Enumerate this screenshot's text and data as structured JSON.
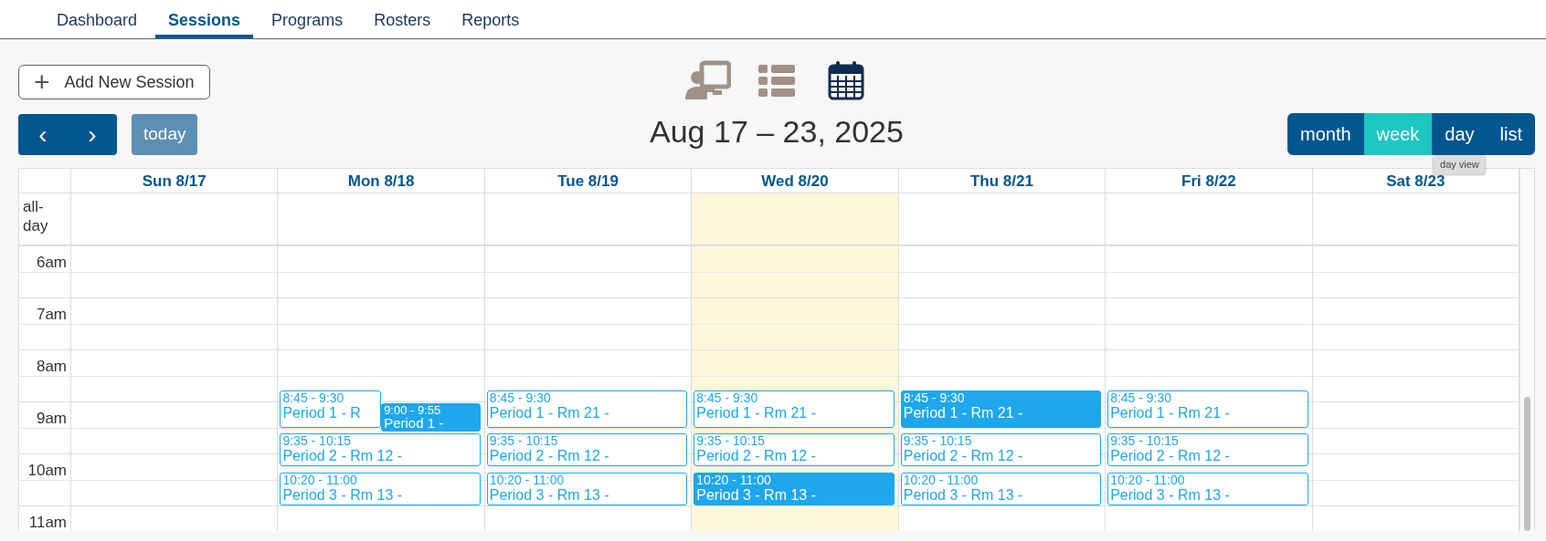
{
  "nav_tabs": [
    {
      "label": "Dashboard",
      "selected": false
    },
    {
      "label": "Sessions",
      "selected": true
    },
    {
      "label": "Programs",
      "selected": false
    },
    {
      "label": "Rosters",
      "selected": false
    },
    {
      "label": "Reports",
      "selected": false
    }
  ],
  "add_button": {
    "icon": "+",
    "label": "Add New Session"
  },
  "view_icons": [
    {
      "kind": "presenter",
      "selected": false
    },
    {
      "kind": "list",
      "selected": false
    },
    {
      "kind": "calendar",
      "selected": true
    }
  ],
  "nav_buttons": {
    "prev": "‹",
    "next": "›",
    "today": "today",
    "today_disabled": true
  },
  "title": "Aug 17 – 23, 2025",
  "view_buttons": [
    {
      "label": "month",
      "selected": false
    },
    {
      "label": "week",
      "selected": true
    },
    {
      "label": "day",
      "selected": false
    },
    {
      "label": "list",
      "selected": false
    }
  ],
  "tooltip": "day view",
  "allday_label": "all-day",
  "time_labels": [
    "6am",
    "7am",
    "8am",
    "9am",
    "10am",
    "11am"
  ],
  "days": [
    {
      "label": "Sun 8/17",
      "today": false
    },
    {
      "label": "Mon 8/18",
      "today": false,
      "events": [
        {
          "time": "8:45 - 9:30",
          "title": "Period 1 - R",
          "selected": false
        },
        {
          "time": "9:00 - 9:55",
          "title": "Period 1 -",
          "selected": true
        },
        {
          "time": "9:35 - 10:15",
          "title": "Period 2 - Rm 12 -",
          "selected": false
        },
        {
          "time": "10:20 - 11:00",
          "title": "Period 3 - Rm 13 -",
          "selected": false
        }
      ]
    },
    {
      "label": "Tue 8/19",
      "today": false,
      "events": [
        {
          "time": "8:45 - 9:30",
          "title": "Period 1 - Rm 21 -",
          "selected": false
        },
        {
          "time": "9:35 - 10:15",
          "title": "Period 2 - Rm 12 -",
          "selected": false
        },
        {
          "time": "10:20 - 11:00",
          "title": "Period 3 - Rm 13 -",
          "selected": false
        }
      ]
    },
    {
      "label": "Wed 8/20",
      "today": true,
      "events": [
        {
          "time": "8:45 - 9:30",
          "title": "Period 1 - Rm 21 -",
          "selected": false
        },
        {
          "time": "9:35 - 10:15",
          "title": "Period 2 - Rm 12 -",
          "selected": false
        },
        {
          "time": "10:20 - 11:00",
          "title": "Period 3 - Rm 13 -",
          "selected": true
        }
      ]
    },
    {
      "label": "Thu 8/21",
      "today": false,
      "events": [
        {
          "time": "8:45 - 9:30",
          "title": "Period 1 - Rm 21 -",
          "selected": true
        },
        {
          "time": "9:35 - 10:15",
          "title": "Period 2 - Rm 12 -",
          "selected": false
        },
        {
          "time": "10:20 - 11:00",
          "title": "Period 3 - Rm 13 -",
          "selected": false
        }
      ]
    },
    {
      "label": "Fri 8/22",
      "today": false,
      "events": [
        {
          "time": "8:45 - 9:30",
          "title": "Period 1 - Rm 21 -",
          "selected": false
        },
        {
          "time": "9:35 - 10:15",
          "title": "Period 2 - Rm 12 -",
          "selected": false
        },
        {
          "time": "10:20 - 11:00",
          "title": "Period 3 - Rm 13 -",
          "selected": false
        }
      ]
    },
    {
      "label": "Sat 8/23",
      "today": false
    }
  ]
}
